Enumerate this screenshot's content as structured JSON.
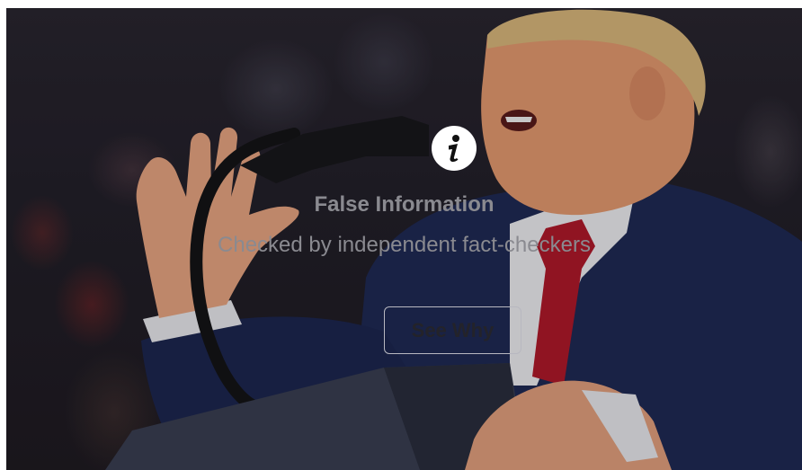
{
  "notice": {
    "title": "False Information",
    "subtitle": "Checked by independent fact-checkers",
    "button_label": "See Why",
    "icon": "info-icon"
  },
  "colors": {
    "text": "#8a8a90",
    "button_border": "#b8b8c0",
    "icon_bg": "#ffffff",
    "suit": "#1f2a55",
    "tie": "#b0192a"
  }
}
